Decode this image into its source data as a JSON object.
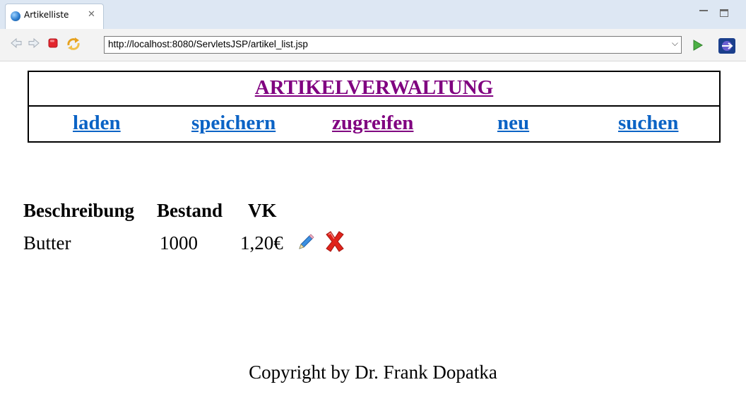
{
  "browser": {
    "tab_title": "Artikelliste",
    "url": "http://localhost:8080/ServletsJSP/artikel_list.jsp"
  },
  "page": {
    "title": "ARTIKELVERWALTUNG",
    "nav": [
      "laden",
      "speichern",
      "zugreifen",
      "neu",
      "suchen"
    ],
    "table": {
      "headers": [
        "Beschreibung",
        "Bestand",
        "VK"
      ],
      "rows": [
        [
          "Butter",
          "1000",
          "1,20€"
        ]
      ]
    },
    "footer": "Copyright by Dr. Frank Dopatka"
  },
  "colors": {
    "link": "#0b63c5",
    "visited_link": "#800080",
    "delete_icon": "#e0231b",
    "tabbar_bg": "#dde7f3"
  }
}
